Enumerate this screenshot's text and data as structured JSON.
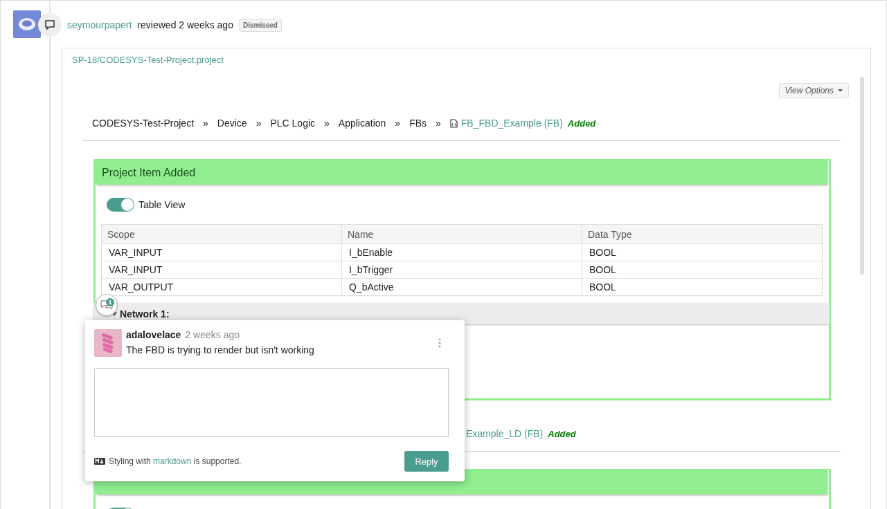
{
  "review": {
    "author": "seymourpapert",
    "action": "reviewed 2 weeks ago",
    "status": "Dismissed"
  },
  "file": {
    "path": "SP-18/CODESYS-Test-Project.project",
    "view_options": "View Options"
  },
  "items": [
    {
      "breadcrumb": [
        "CODESYS-Test-Project",
        "Device",
        "PLC Logic",
        "Application",
        "FBs"
      ],
      "separator": "»",
      "target": "FB_FBD_Example (FB)",
      "change": "Added",
      "card_title": "Project Item Added",
      "table_view": {
        "label": "Table View",
        "on": true
      },
      "table": {
        "columns": [
          "Scope",
          "Name",
          "Data Type"
        ],
        "rows": [
          [
            "VAR_INPUT",
            "I_bEnable",
            "BOOL"
          ],
          [
            "VAR_INPUT",
            "I_bTrigger",
            "BOOL"
          ],
          [
            "VAR_OUTPUT",
            "Q_bActive",
            "BOOL"
          ]
        ]
      },
      "network": {
        "label": "Network 1:",
        "expanded": true
      }
    },
    {
      "target": "Example_LD (FB)",
      "change": "Added",
      "table_view": {
        "on": true
      }
    }
  ],
  "comment_popup": {
    "count": "1",
    "author": "adalovelace",
    "time": "2 weeks ago",
    "message": "The FBD is trying to render but isn't working",
    "hint_before": "Styling with ",
    "hint_link": "markdown",
    "hint_after": " is supported.",
    "button": "Reply"
  }
}
